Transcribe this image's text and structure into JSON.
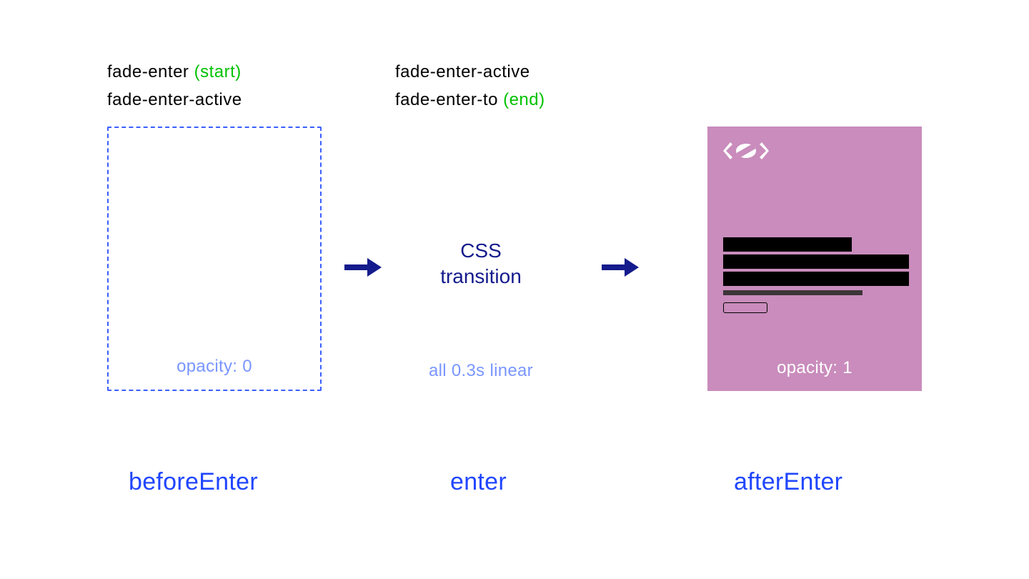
{
  "stages": {
    "before": {
      "label1_text": "fade-enter ",
      "label1_suffix": "(start)",
      "label2_text": "fade-enter-active",
      "opacity_text": "opacity: 0",
      "hook": "beforeEnter"
    },
    "enter": {
      "label1_text": "fade-enter-active",
      "label2_text": "fade-enter-to ",
      "label2_suffix": "(end)",
      "css_line1": "CSS",
      "css_line2": "transition",
      "timing": "all 0.3s linear",
      "hook": "enter"
    },
    "after": {
      "opacity_text": "opacity: 1",
      "hook": "afterEnter"
    }
  },
  "colors": {
    "dashed_border": "#3b5fff",
    "solid_fill": "#c98cbc",
    "hook_text": "#2046ff",
    "arrow": "#141b8c",
    "accent_green": "#00c200",
    "faded_blue": "#7a96ff"
  }
}
